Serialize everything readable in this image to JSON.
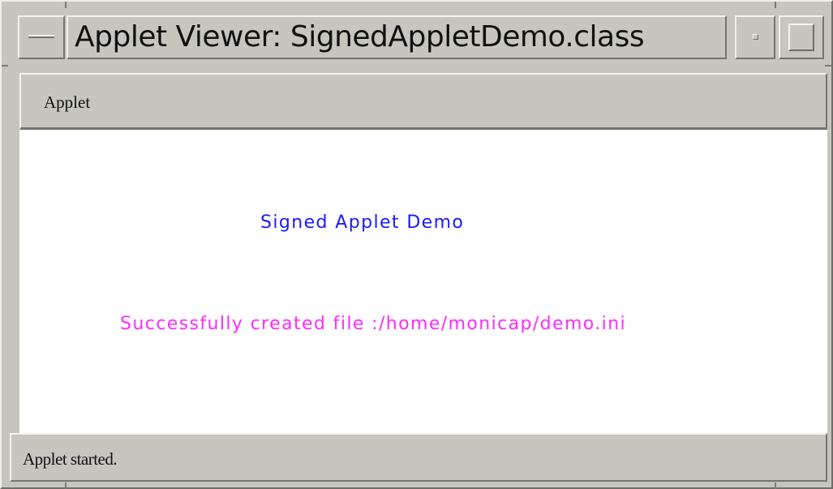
{
  "window": {
    "title": "Applet Viewer: SignedAppletDemo.class"
  },
  "menubar": {
    "items": [
      {
        "label": "Applet"
      }
    ]
  },
  "applet": {
    "heading": "Signed Applet Demo",
    "message": "Successfully created file :/home/monicap/demo.ini",
    "heading_color": "#1a1aff",
    "message_color": "#ff2bff"
  },
  "status": {
    "text": "Applet started."
  },
  "icons": {
    "window_menu": "window-menu-icon",
    "minimize": "minimize-icon",
    "maximize": "maximize-icon"
  }
}
